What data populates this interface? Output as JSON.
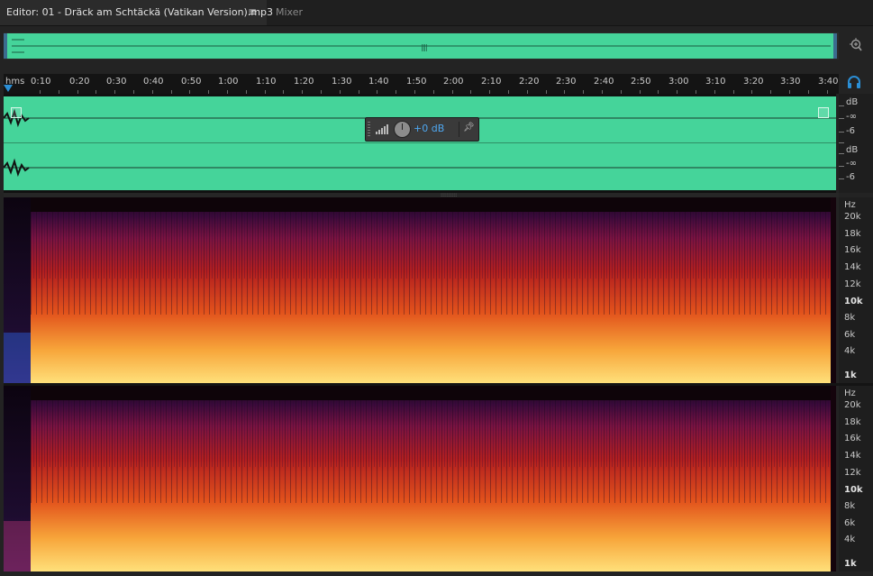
{
  "tabs": {
    "editor_title": "Editor: 01 - Dräck am Schtäckä (Vatikan Version).mp3",
    "menu_glyph": "≡",
    "mixer": "Mixer"
  },
  "ruler": {
    "unit": "hms",
    "labels": [
      "0:10",
      "0:20",
      "0:30",
      "0:40",
      "0:50",
      "1:00",
      "1:10",
      "1:20",
      "1:30",
      "1:40",
      "1:50",
      "2:00",
      "2:10",
      "2:20",
      "2:30",
      "2:40",
      "2:50",
      "3:00",
      "3:10",
      "3:20",
      "3:30",
      "3:40"
    ]
  },
  "waveform": {
    "color": "#45d49a",
    "channel_top": {
      "db_unit": "dB",
      "inf": "-∞",
      "minus6": "-6"
    },
    "channel_bottom": {
      "db_unit": "dB",
      "inf": "-∞",
      "minus6": "-6"
    }
  },
  "hud": {
    "gain": "+0 dB",
    "level_icon": "level-meter-icon",
    "knob_icon": "volume-knob-icon",
    "pin_icon": "pin-icon"
  },
  "spectral": {
    "unit": "Hz",
    "labels": [
      "20k",
      "18k",
      "16k",
      "14k",
      "12k",
      "10k",
      "8k",
      "6k",
      "4k",
      "1k"
    ],
    "colors": {
      "low": "#1a0510",
      "mid": "#b11f1d",
      "high": "#ffd75a"
    }
  },
  "icons": {
    "zoom": "zoom-in-icon",
    "headphones": "headphones-icon"
  },
  "colors": {
    "accent": "#2b8fd6",
    "background": "#232323"
  }
}
